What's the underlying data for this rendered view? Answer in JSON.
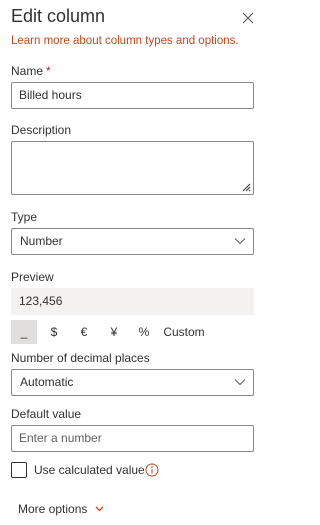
{
  "panel": {
    "title": "Edit column",
    "learn_more": "Learn more about column types and options."
  },
  "name_field": {
    "label": "Name",
    "required_marker": "*",
    "value": "Billed hours"
  },
  "description_field": {
    "label": "Description",
    "value": ""
  },
  "type_field": {
    "label": "Type",
    "selected": "Number"
  },
  "preview": {
    "label": "Preview",
    "value": "123,456"
  },
  "format_options": {
    "none": "_",
    "dollar": "$",
    "euro": "€",
    "yen": "¥",
    "percent": "%",
    "custom": "Custom",
    "selected": "none"
  },
  "decimal_places": {
    "label": "Number of decimal places",
    "selected": "Automatic"
  },
  "default_value": {
    "label": "Default value",
    "placeholder": "Enter a number"
  },
  "calculated": {
    "label": "Use calculated value",
    "checked": false
  },
  "more_options": {
    "label": "More options"
  },
  "colors": {
    "accent_link": "#c04a1d",
    "required": "#a4262c",
    "info_icon": "#c04a1d"
  }
}
